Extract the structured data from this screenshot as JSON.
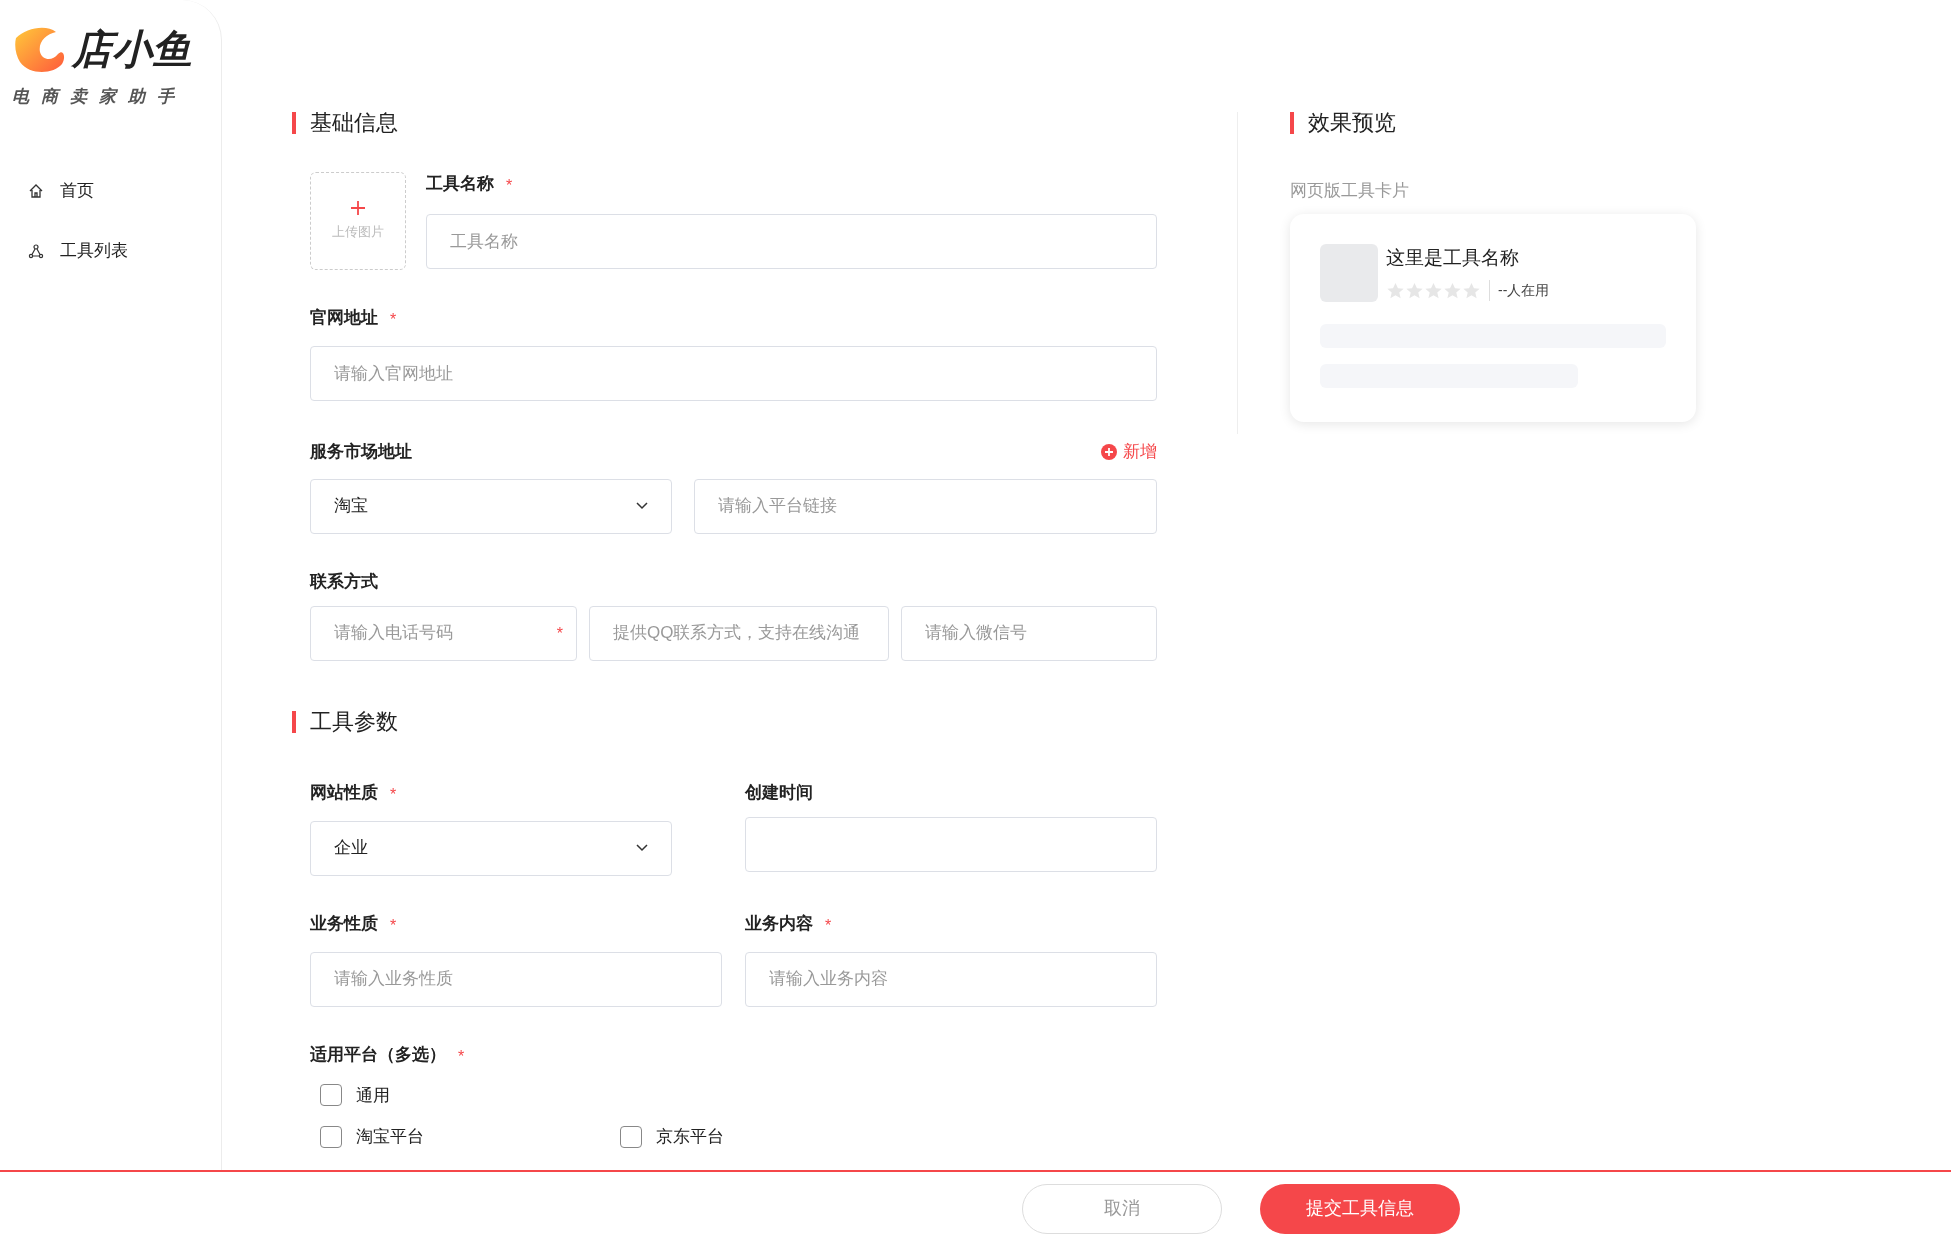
{
  "logo": {
    "name": "店小鱼",
    "tagline": "电商卖家助手"
  },
  "sidebar": {
    "items": [
      {
        "label": "首页"
      },
      {
        "label": "工具列表"
      }
    ]
  },
  "basic_info": {
    "title": "基础信息",
    "upload": {
      "label": "上传图片"
    },
    "tool_name": {
      "label": "工具名称",
      "required_mark": "*",
      "placeholder": "工具名称"
    },
    "website": {
      "label": "官网地址",
      "required_mark": "*",
      "placeholder": "请输入官网地址"
    },
    "market": {
      "label": "服务市场地址",
      "add_link": "新增",
      "platform": "淘宝",
      "placeholder": "请输入平台链接"
    },
    "contact": {
      "label": "联系方式",
      "fields": [
        {
          "placeholder": "请输入电话号码",
          "required_mark": "*"
        },
        {
          "placeholder": "提供QQ联系方式，支持在线沟通"
        },
        {
          "placeholder": "请输入微信号"
        }
      ]
    }
  },
  "tool_params": {
    "title": "工具参数",
    "site_type": {
      "label": "网站性质",
      "required_mark": "*",
      "value": "企业"
    },
    "created": {
      "label": "创建时间"
    },
    "business_type": {
      "label": "业务性质",
      "required_mark": "*",
      "placeholder": "请输入业务性质"
    },
    "business_content": {
      "label": "业务内容",
      "required_mark": "*",
      "placeholder": "请输入业务内容"
    },
    "platforms": {
      "label": "适用平台（多选）",
      "required_mark": "*",
      "option_rows": [
        [
          {
            "label": "通用",
            "checked": false
          }
        ],
        [
          {
            "label": "淘宝平台",
            "checked": false
          },
          {
            "label": "京东平台",
            "checked": false
          }
        ]
      ]
    }
  },
  "preview": {
    "title": "效果预览",
    "caption": "网页版工具卡片",
    "card": {
      "name": "这里是工具名称",
      "stars": 0,
      "users": "--人在用"
    }
  },
  "footer": {
    "cancel": "取消",
    "submit": "提交工具信息"
  }
}
